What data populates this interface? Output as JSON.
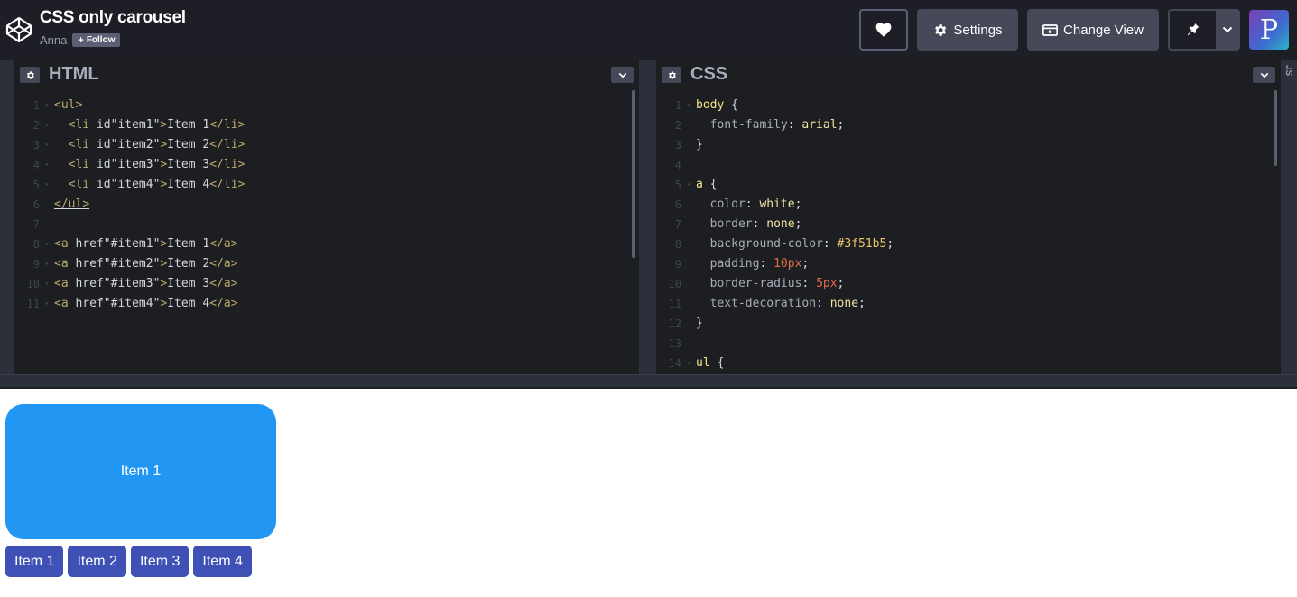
{
  "header": {
    "title": "CSS only carousel",
    "author": "Anna",
    "follow_label": "Follow",
    "settings_label": "Settings",
    "change_view_label": "Change View",
    "avatar_letter": "P"
  },
  "editors": {
    "html_title": "HTML",
    "css_title": "CSS",
    "js_tab": "JS",
    "html_lines": [
      "1",
      "2",
      "3",
      "4",
      "5",
      "6",
      "7",
      "8",
      "9",
      "10",
      "11"
    ],
    "html_code": [
      "<ul>",
      "  <li id=\"item1\">Item 1</li>",
      "  <li id=\"item2\">Item 2</li>",
      "  <li id=\"item3\">Item 3</li>",
      "  <li id=\"item4\">Item 4</li>",
      "</ul>",
      "",
      "<a href=\"#item1\">Item 1</a>",
      "<a href=\"#item2\">Item 2</a>",
      "<a href=\"#item3\">Item 3</a>",
      "<a href=\"#item4\">Item 4</a>"
    ],
    "css_code": [
      "body {",
      "  font-family: arial;",
      "}",
      "",
      "a {",
      "  color: white;",
      "  border: none;",
      "  background-color: #3f51b5;",
      "  padding: 10px;",
      "  border-radius: 5px;",
      "  text-decoration: none;",
      "}",
      "",
      "ul {"
    ]
  },
  "preview": {
    "slide_text": "Item 1",
    "nav": [
      "Item 1",
      "Item 2",
      "Item 3",
      "Item 4"
    ],
    "slide_color": "#2196f3",
    "nav_color": "#3f51b5"
  }
}
